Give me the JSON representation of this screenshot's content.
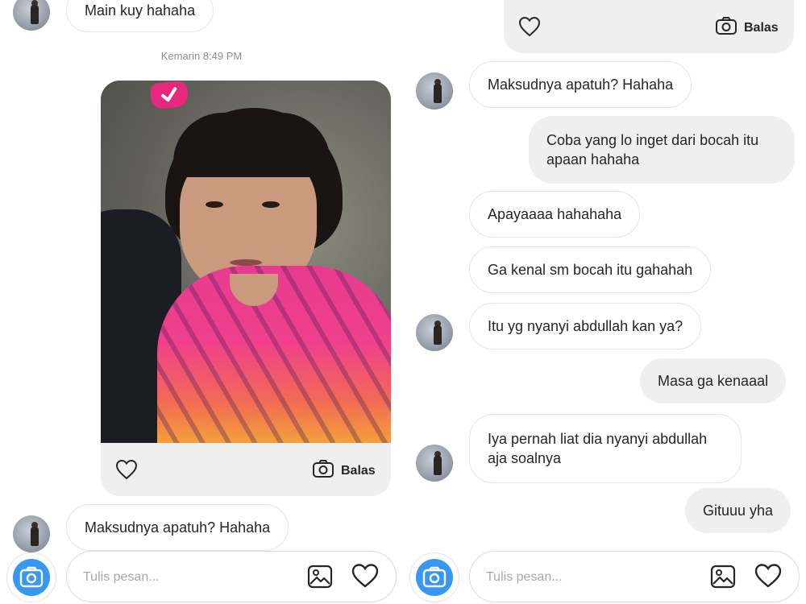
{
  "left": {
    "messages": {
      "top_incoming": "Main kuy hahaha",
      "timestamp": "Kemarin 8:49 PM",
      "shared_post_reply": "Balas",
      "bottom_incoming": "Maksudnya apatuh? Hahaha"
    },
    "composer": {
      "placeholder": "Tulis pesan..."
    }
  },
  "right": {
    "top_card_reply": "Balas",
    "messages": [
      {
        "direction": "in",
        "avatar": true,
        "text": "Maksudnya apatuh? Hahaha"
      },
      {
        "direction": "out",
        "text": "Coba yang lo inget dari bocah itu apaan hahaha"
      },
      {
        "direction": "in",
        "avatar": false,
        "text": "Apayaaaa hahahaha"
      },
      {
        "direction": "in",
        "avatar": false,
        "text": "Ga kenal sm bocah itu gahahah"
      },
      {
        "direction": "in",
        "avatar": true,
        "text": "Itu yg nyanyi abdullah kan ya?"
      },
      {
        "direction": "out",
        "text": "Masa ga kenaaal"
      },
      {
        "direction": "in",
        "avatar": true,
        "text": "Iya pernah liat dia nyanyi abdullah aja soalnya"
      },
      {
        "direction": "out",
        "text": "Gituuu yha"
      }
    ],
    "composer": {
      "placeholder": "Tulis pesan..."
    }
  },
  "icons": {
    "camera": "camera-icon",
    "gallery": "gallery-icon",
    "heart": "heart-icon",
    "reply_camera": "camera-outline-icon",
    "sticker": "heart-sticker-icon"
  },
  "colors": {
    "accent": "#3897f0",
    "bubble_out": "#efefef",
    "bubble_in_border": "#e6e6e6",
    "sticker": "#e8287e",
    "muted_text": "#8e8e8e"
  }
}
